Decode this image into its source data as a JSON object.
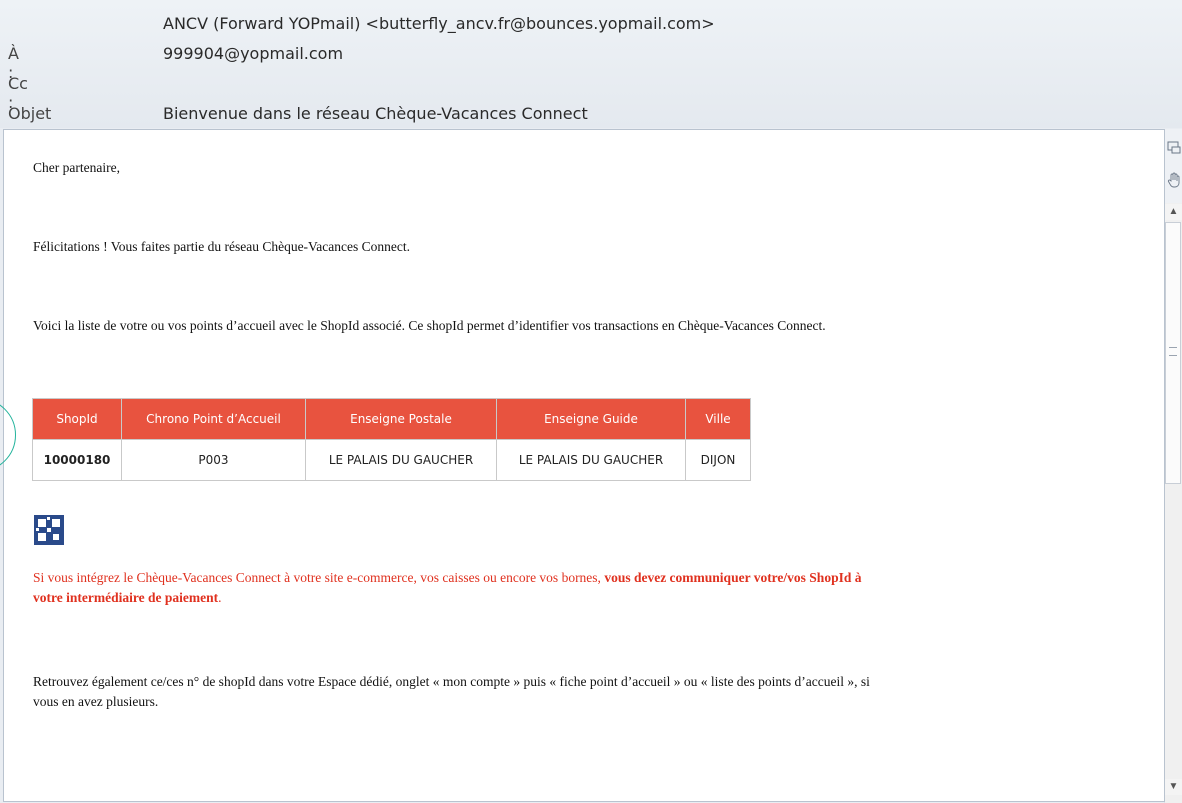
{
  "header": {
    "from": "ANCV (Forward YOPmail) <butterfly_ancv.fr@bounces.yopmail.com>",
    "to_label": "À :",
    "to_value": "999904@yopmail.com",
    "cc_label": "Cc :",
    "subject_label": "Objet :",
    "subject_value": "Bienvenue dans le réseau Chèque-Vacances Connect"
  },
  "body": {
    "greeting": "Cher partenaire,",
    "congrats": "Félicitations ! Vous faites partie du réseau Chèque-Vacances Connect.",
    "list_intro": "Voici la liste de  votre ou vos points d’accueil avec le ShopId associé. Ce shopId permet d’identifier vos transactions en Chèque-Vacances Connect.",
    "table": {
      "headers": [
        "ShopId",
        "Chrono Point d’Accueil",
        "Enseigne Postale",
        "Enseigne Guide",
        "Ville"
      ],
      "rows": [
        [
          "10000180",
          "P003",
          "LE PALAIS DU GAUCHER",
          "LE PALAIS DU GAUCHER",
          "DIJON"
        ]
      ]
    },
    "notice_line1_normal": "Si vous intégrez le Chèque-Vacances Connect à votre site e-commerce, vos caisses ou encore vos bornes, ",
    "notice_line1_bold": "vous devez communiquer votre/vos ShopId à",
    "notice_line2_bold": "votre intermédiaire de paiement",
    "notice_line2_end": ".",
    "footer_line1": "Retrouvez également ce/ces n° de shopId dans votre Espace dédié, onglet « mon compte » puis « fiche point d’accueil » ou « liste des points d’accueil », si",
    "footer_line2": "vous en avez plusieurs."
  },
  "colors": {
    "table_header": "#e8533f",
    "notice_red": "#e0311f",
    "header_bg": "#e9edf2"
  },
  "icons": {
    "side_top": "screen-icon",
    "side_hand": "hand-icon",
    "grip": "grip-icon",
    "qr": "qr-code-icon"
  }
}
